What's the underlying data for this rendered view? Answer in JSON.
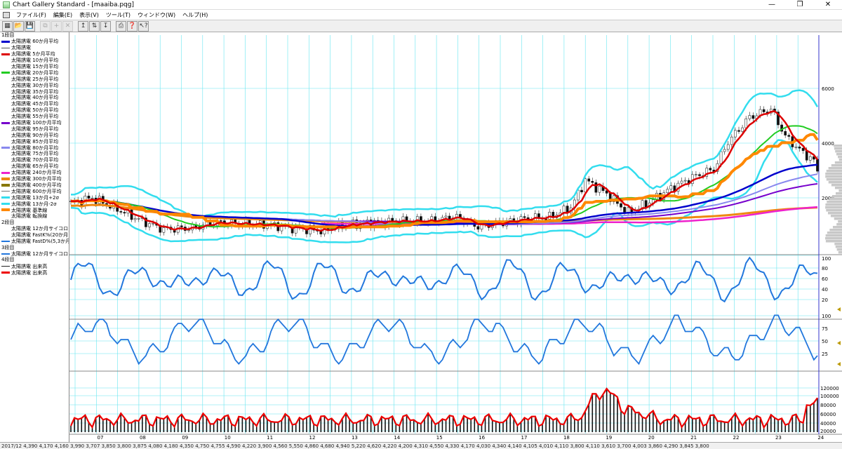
{
  "window": {
    "title": "Chart Gallery Standard - [maaiba.pqg]",
    "controls": [
      "—",
      "❐",
      "✕"
    ]
  },
  "menu": [
    "ファイル(F)",
    "編集(E)",
    "表示(V)",
    "ツール(T)",
    "ウィンドウ(W)",
    "ヘルプ(H)"
  ],
  "toolbar": [
    {
      "name": "chart-button",
      "glyph": "▦"
    },
    {
      "name": "open-button",
      "glyph": "📂"
    },
    {
      "name": "save-button",
      "glyph": "💾"
    },
    {
      "name": "copy-button",
      "glyph": "⧉",
      "disabled": true
    },
    {
      "name": "crosshair-button",
      "glyph": "+",
      "disabled": true
    },
    {
      "name": "cut-button",
      "glyph": "✕",
      "disabled": true
    },
    {
      "name": "rise-button",
      "glyph": "↥"
    },
    {
      "name": "range-button",
      "glyph": "⇅"
    },
    {
      "name": "fall-button",
      "glyph": "↧"
    },
    {
      "name": "print-button",
      "glyph": "⎙"
    },
    {
      "name": "info-button",
      "glyph": "❓"
    },
    {
      "name": "whatsthis-button",
      "glyph": "↖?"
    }
  ],
  "legend": [
    {
      "type": "section",
      "label": "1段目"
    },
    {
      "label": "太陽誘電 60か月平均",
      "color": "#0000cc",
      "weight": 3
    },
    {
      "label": "太陽誘電",
      "color": "#555555",
      "weight": 1
    },
    {
      "label": "太陽誘電 5か月平均",
      "color": "#dd0000",
      "weight": 3
    },
    {
      "label": "太陽誘電 10か月平均",
      "color": "",
      "weight": 0
    },
    {
      "label": "太陽誘電 15か月平均",
      "color": "",
      "weight": 0
    },
    {
      "label": "太陽誘電 20か月平均",
      "color": "#22cc22",
      "weight": 3
    },
    {
      "label": "太陽誘電 25か月平均",
      "color": "",
      "weight": 0
    },
    {
      "label": "太陽誘電 30か月平均",
      "color": "",
      "weight": 0
    },
    {
      "label": "太陽誘電 35か月平均",
      "color": "",
      "weight": 0
    },
    {
      "label": "太陽誘電 40か月平均",
      "color": "",
      "weight": 0
    },
    {
      "label": "太陽誘電 45か月平均",
      "color": "",
      "weight": 0
    },
    {
      "label": "太陽誘電 50か月平均",
      "color": "",
      "weight": 0
    },
    {
      "label": "太陽誘電 55か月平均",
      "color": "",
      "weight": 0
    },
    {
      "label": "太陽誘電 100か月平均",
      "color": "#7700cc",
      "weight": 3
    },
    {
      "label": "太陽誘電 95か月平均",
      "color": "",
      "weight": 0
    },
    {
      "label": "太陽誘電 90か月平均",
      "color": "",
      "weight": 0
    },
    {
      "label": "太陽誘電 85か月平均",
      "color": "",
      "weight": 0
    },
    {
      "label": "太陽誘電 80か月平均",
      "color": "#8888ee",
      "weight": 3
    },
    {
      "label": "太陽誘電 75か月平均",
      "color": "",
      "weight": 0
    },
    {
      "label": "太陽誘電 70か月平均",
      "color": "",
      "weight": 0
    },
    {
      "label": "太陽誘電 65か月平均",
      "color": "",
      "weight": 0
    },
    {
      "label": "太陽誘電 240か月平均",
      "color": "#ee22cc",
      "weight": 3
    },
    {
      "label": "太陽誘電 300か月平均",
      "color": "#ee8811",
      "weight": 4
    },
    {
      "label": "太陽誘電 400か月平均",
      "color": "#887700",
      "weight": 4
    },
    {
      "label": "太陽誘電 600か月平均",
      "color": "#777777",
      "weight": 1
    },
    {
      "label": "太陽誘電 13か月+2σ",
      "color": "#33ddee",
      "weight": 3
    },
    {
      "label": "太陽誘電 13か月-2σ",
      "color": "#33ddee",
      "weight": 3
    },
    {
      "label": "太陽誘電 基準線",
      "color": "#ff8800",
      "weight": 4
    },
    {
      "label": "太陽誘電 転換線",
      "color": "",
      "weight": 0
    },
    {
      "type": "section",
      "label": "2段目"
    },
    {
      "label": "太陽誘電 12か月サイコロ",
      "color": "",
      "weight": 0
    },
    {
      "label": "太陽誘電 FastK%(20か月",
      "color": "",
      "weight": 0
    },
    {
      "label": "太陽誘電 FastD%(5,3か月",
      "color": "#2277dd",
      "weight": 2
    },
    {
      "type": "section",
      "label": "3段目"
    },
    {
      "label": "太陽誘電 12か月サイコロ",
      "color": "#2277dd",
      "weight": 2
    },
    {
      "type": "section",
      "label": "4段目"
    },
    {
      "label": "太陽誘電 出来高",
      "color": "#222222",
      "weight": 1
    },
    {
      "label": "太陽誘電 出来高",
      "color": "#ee0000",
      "weight": 3
    }
  ],
  "axes": {
    "price_ticks": [
      "6000",
      "4000",
      "2000"
    ],
    "price_unit": "",
    "osc1_ticks": [
      "100",
      "80",
      "60",
      "40",
      "20"
    ],
    "osc2_ticks": [
      "100",
      "75",
      "50",
      "25"
    ],
    "volume_ticks": [
      "120000",
      "100000",
      "80000",
      "60000",
      "40000",
      "20000"
    ],
    "x_labels": [
      "07",
      "08",
      "09",
      "10",
      "11",
      "12",
      "13",
      "14",
      "15",
      "16",
      "17",
      "18",
      "19",
      "20",
      "21",
      "22",
      "23",
      "24"
    ]
  },
  "colors": {
    "grid": "#66e6f0",
    "cursor": "#3333cc",
    "ma60": "#0000cc",
    "ma5": "#dd0000",
    "ma20": "#22cc22",
    "ma100": "#7700cc",
    "ma80": "#8888ee",
    "ma240": "#ee22cc",
    "ma300": "#ee8811",
    "bollinger": "#33ddee",
    "kijun": "#ff8800",
    "oscillator": "#2277dd",
    "volume_line": "#ee0000"
  },
  "status": "2017/12  4,390  4,170  4,160  3,990  3,707  3,850  3,800  3,875  4,080  4,180  4,350  4,750  4,755  4,590  4,220  3,900  4,560  5,550  4,860  4,680  4,940  5,220  4,620  4,220  4,200  4,310  4,550  4,330  4,170  4,030  4,340  4,140  4,105  4,010  4,110  3,800  4,110  3,610  3,700  4,003  3,860  4,290  3,845  3,800"
}
